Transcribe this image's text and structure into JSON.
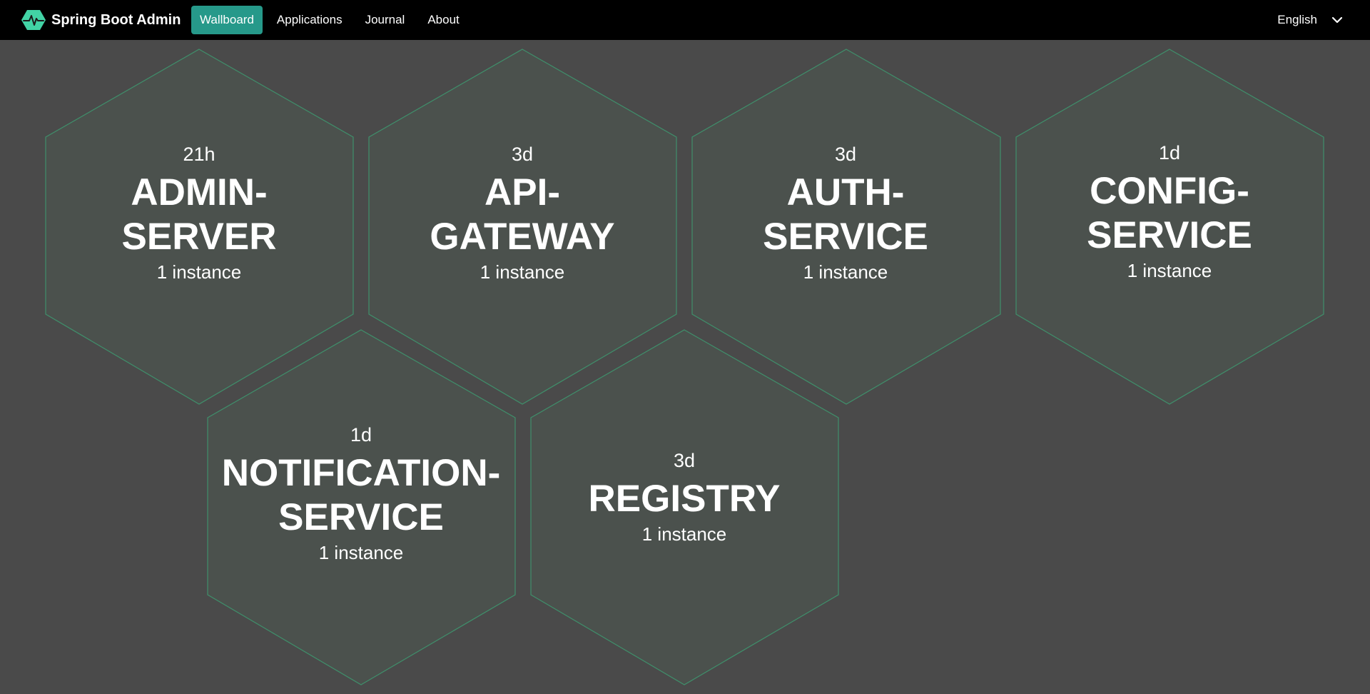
{
  "navbar": {
    "brand": "Spring Boot Admin",
    "items": [
      {
        "label": "Wallboard",
        "active": true
      },
      {
        "label": "Applications",
        "active": false
      },
      {
        "label": "Journal",
        "active": false
      },
      {
        "label": "About",
        "active": false
      }
    ],
    "language": "English"
  },
  "colors": {
    "accent": "#26998a",
    "hex_fill": "#4b514d",
    "hex_stroke": "#3f8f6b",
    "background": "#4a4a4a",
    "navbar": "#000000"
  },
  "applications": [
    {
      "uptime": "21h",
      "name_line1": "ADMIN-",
      "name_line2": "SERVER",
      "instances": "1 instance"
    },
    {
      "uptime": "3d",
      "name_line1": "API-",
      "name_line2": "GATEWAY",
      "instances": "1 instance"
    },
    {
      "uptime": "3d",
      "name_line1": "AUTH-",
      "name_line2": "SERVICE",
      "instances": "1 instance"
    },
    {
      "uptime": "1d",
      "name_line1": "CONFIG-",
      "name_line2": "SERVICE",
      "instances": "1 instance"
    },
    {
      "uptime": "1d",
      "name_line1": "NOTIFICATION-",
      "name_line2": "SERVICE",
      "instances": "1 instance"
    },
    {
      "uptime": "3d",
      "name_line1": "REGISTRY",
      "name_line2": "",
      "instances": "1 instance"
    }
  ]
}
